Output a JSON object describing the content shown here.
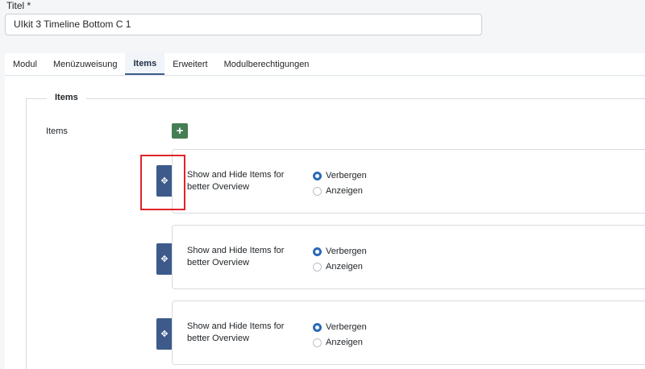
{
  "title_field": {
    "label": "Titel *",
    "value": "UIkit 3 Timeline Bottom C 1"
  },
  "tabs": [
    {
      "label": "Modul",
      "active": false
    },
    {
      "label": "Menüzuweisung",
      "active": false
    },
    {
      "label": "Items",
      "active": true
    },
    {
      "label": "Erweitert",
      "active": false
    },
    {
      "label": "Modulberechtigungen",
      "active": false
    }
  ],
  "fieldset": {
    "legend": "Items",
    "field_label": "Items",
    "add_button_label": "+"
  },
  "items": [
    {
      "label": "Show and Hide Items for better Overview",
      "handle_icon": "move-arrows-icon",
      "options": [
        {
          "label": "Verbergen",
          "checked": true
        },
        {
          "label": "Anzeigen",
          "checked": false
        }
      ]
    },
    {
      "label": "Show and Hide Items for better Overview",
      "handle_icon": "move-arrows-icon",
      "options": [
        {
          "label": "Verbergen",
          "checked": true
        },
        {
          "label": "Anzeigen",
          "checked": false
        }
      ]
    },
    {
      "label": "Show and Hide Items for better Overview",
      "handle_icon": "move-arrows-icon",
      "options": [
        {
          "label": "Verbergen",
          "checked": true
        },
        {
          "label": "Anzeigen",
          "checked": false
        }
      ]
    }
  ],
  "colors": {
    "accent_blue": "#3d5a8a",
    "add_green": "#457d54",
    "radio_checked": "#2a69b8",
    "highlight_red": "#e0242b"
  }
}
